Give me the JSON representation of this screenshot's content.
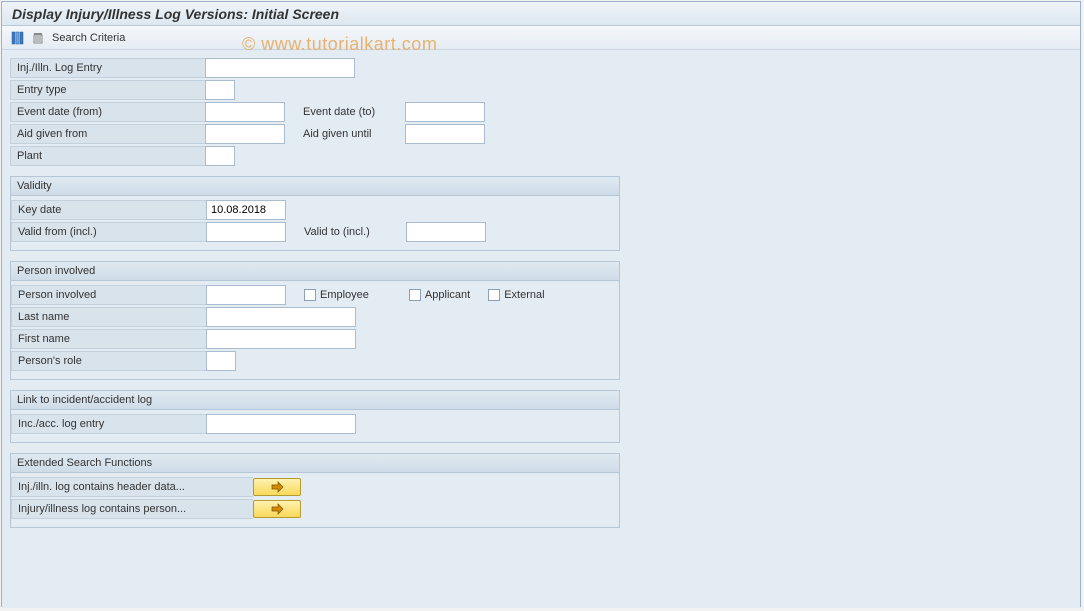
{
  "title": "Display Injury/Illness Log Versions: Initial Screen",
  "toolbar": {
    "choose_columns_icon": "choose-columns",
    "container_icon": "container",
    "search_criteria_label": "Search Criteria"
  },
  "watermark": "© www.tutorialkart.com",
  "top": {
    "inj_log_entry_label": "Inj./Illn. Log Entry",
    "inj_log_entry_value": "",
    "entry_type_label": "Entry type",
    "entry_type_value": "",
    "event_from_label": "Event date (from)",
    "event_from_value": "",
    "event_to_label": "Event date (to)",
    "event_to_value": "",
    "aid_from_label": "Aid given from",
    "aid_from_value": "",
    "aid_until_label": "Aid given until",
    "aid_until_value": "",
    "plant_label": "Plant",
    "plant_value": ""
  },
  "validity": {
    "title": "Validity",
    "key_date_label": "Key date",
    "key_date_value": "10.08.2018",
    "valid_from_label": "Valid from (incl.)",
    "valid_from_value": "",
    "valid_to_label": "Valid to (incl.)",
    "valid_to_value": ""
  },
  "person": {
    "title": "Person involved",
    "person_label": "Person involved",
    "person_value": "",
    "employee_label": "Employee",
    "applicant_label": "Applicant",
    "external_label": "External",
    "last_name_label": "Last name",
    "last_name_value": "",
    "first_name_label": "First name",
    "first_name_value": "",
    "role_label": "Person's role",
    "role_value": ""
  },
  "link": {
    "title": "Link to incident/accident log",
    "entry_label": "Inc./acc. log entry",
    "entry_value": ""
  },
  "ext": {
    "title": "Extended Search Functions",
    "header_label": "Inj./illn. log contains header data...",
    "person_label": "Injury/illness log contains person..."
  }
}
